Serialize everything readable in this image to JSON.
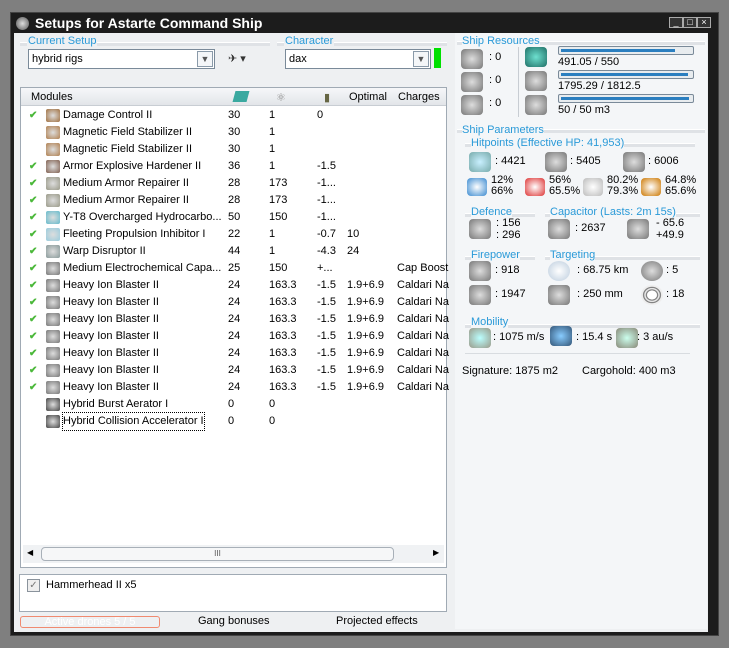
{
  "window": {
    "title": "Setups for Astarte Command Ship"
  },
  "setup": {
    "label": "Current Setup",
    "value": "hybrid rigs"
  },
  "character": {
    "label": "Character",
    "value": "dax",
    "status_color": "#00e000"
  },
  "table": {
    "headers": [
      "Modules",
      "",
      "",
      "",
      "Optimal",
      "Charges"
    ],
    "rows": [
      {
        "checked": true,
        "name": "Damage Control II",
        "cpu": "30",
        "pg": "1",
        "cap": "0",
        "optimal": "",
        "charges": ""
      },
      {
        "checked": false,
        "name": "Magnetic Field Stabilizer II",
        "cpu": "30",
        "pg": "1",
        "cap": "",
        "optimal": "",
        "charges": ""
      },
      {
        "checked": false,
        "name": "Magnetic Field Stabilizer II",
        "cpu": "30",
        "pg": "1",
        "cap": "",
        "optimal": "",
        "charges": ""
      },
      {
        "checked": true,
        "name": "Armor Explosive Hardener II",
        "cpu": "36",
        "pg": "1",
        "cap": "-1.5",
        "optimal": "",
        "charges": ""
      },
      {
        "checked": true,
        "name": "Medium Armor Repairer II",
        "cpu": "28",
        "pg": "173",
        "cap": "-1...",
        "optimal": "",
        "charges": ""
      },
      {
        "checked": true,
        "name": "Medium Armor Repairer II",
        "cpu": "28",
        "pg": "173",
        "cap": "-1...",
        "optimal": "",
        "charges": ""
      },
      {
        "checked": true,
        "name": "Y-T8 Overcharged Hydrocarbo...",
        "cpu": "50",
        "pg": "150",
        "cap": "-1...",
        "optimal": "",
        "charges": ""
      },
      {
        "checked": true,
        "name": "Fleeting Propulsion Inhibitor I",
        "cpu": "22",
        "pg": "1",
        "cap": "-0.7",
        "optimal": "10",
        "charges": ""
      },
      {
        "checked": true,
        "name": "Warp Disruptor II",
        "cpu": "44",
        "pg": "1",
        "cap": "-4.3",
        "optimal": "24",
        "charges": ""
      },
      {
        "checked": true,
        "name": "Medium Electrochemical Capa...",
        "cpu": "25",
        "pg": "150",
        "cap": "+...",
        "optimal": "",
        "charges": "Cap Boost"
      },
      {
        "checked": true,
        "name": "Heavy Ion Blaster II",
        "cpu": "24",
        "pg": "163.3",
        "cap": "-1.5",
        "optimal": "1.9+6.9",
        "charges": "Caldari Na"
      },
      {
        "checked": true,
        "name": "Heavy Ion Blaster II",
        "cpu": "24",
        "pg": "163.3",
        "cap": "-1.5",
        "optimal": "1.9+6.9",
        "charges": "Caldari Na"
      },
      {
        "checked": true,
        "name": "Heavy Ion Blaster II",
        "cpu": "24",
        "pg": "163.3",
        "cap": "-1.5",
        "optimal": "1.9+6.9",
        "charges": "Caldari Na"
      },
      {
        "checked": true,
        "name": "Heavy Ion Blaster II",
        "cpu": "24",
        "pg": "163.3",
        "cap": "-1.5",
        "optimal": "1.9+6.9",
        "charges": "Caldari Na"
      },
      {
        "checked": true,
        "name": "Heavy Ion Blaster II",
        "cpu": "24",
        "pg": "163.3",
        "cap": "-1.5",
        "optimal": "1.9+6.9",
        "charges": "Caldari Na"
      },
      {
        "checked": true,
        "name": "Heavy Ion Blaster II",
        "cpu": "24",
        "pg": "163.3",
        "cap": "-1.5",
        "optimal": "1.9+6.9",
        "charges": "Caldari Na"
      },
      {
        "checked": true,
        "name": "Heavy Ion Blaster II",
        "cpu": "24",
        "pg": "163.3",
        "cap": "-1.5",
        "optimal": "1.9+6.9",
        "charges": "Caldari Na"
      },
      {
        "checked": false,
        "name": "Hybrid Burst Aerator I",
        "cpu": "0",
        "pg": "0",
        "cap": "",
        "optimal": "",
        "charges": ""
      },
      {
        "checked": false,
        "name": "Hybrid Collision Accelerator I",
        "cpu": "0",
        "pg": "0",
        "cap": "",
        "optimal": "",
        "charges": ""
      }
    ],
    "scroll_grip": "III"
  },
  "drones": {
    "item": "Hammerhead II x5",
    "checked": true
  },
  "bottom_tabs": [
    "Active drones 5 / 5",
    "Gang bonuses",
    "Projected effects"
  ],
  "resources": {
    "label": "Ship Resources",
    "turret_hardpoints": ": 0",
    "launcher_hardpoints": ": 0",
    "rig_slots": ": 0",
    "cpu": {
      "text": "491.05 / 550",
      "fraction": 0.893
    },
    "powergrid": {
      "text": "1795.29 / 1812.5",
      "fraction": 0.99
    },
    "drone_bay": {
      "text": "50 / 50 m3",
      "fraction": 1.0
    }
  },
  "params": {
    "label": "Ship Parameters",
    "hitpoints_label": "Hitpoints (Effective HP: 41,953)",
    "shield": ": 4421",
    "armor": ": 5405",
    "structure": ": 6006",
    "resists": [
      [
        "12%",
        "66%"
      ],
      [
        "56%",
        "65.5%"
      ],
      [
        "80.2%",
        "79.3%"
      ],
      [
        "64.8%",
        "65.6%"
      ]
    ],
    "defence_label": "Defence",
    "defence": [
      ": 156",
      ": 296"
    ],
    "capacitor_label": "Capacitor (Lasts: 2m 15s)",
    "capacitor": ": 2637",
    "cap_delta": [
      "- 65.6",
      "+49.9"
    ],
    "firepower_label": "Firepower",
    "dps": ": 918",
    "volley": ": 1947",
    "targeting_label": "Targeting",
    "range": ": 68.75 km",
    "max_targets": ": 5",
    "scan_res": ": 250 mm",
    "sensor": ": 18",
    "mobility_label": "Mobility",
    "speed": ": 1075 m/s",
    "align": ": 15.4 s",
    "warp": ": 3 au/s",
    "signature": "Signature: 1875 m2",
    "cargo": "Cargohold: 400 m3"
  }
}
